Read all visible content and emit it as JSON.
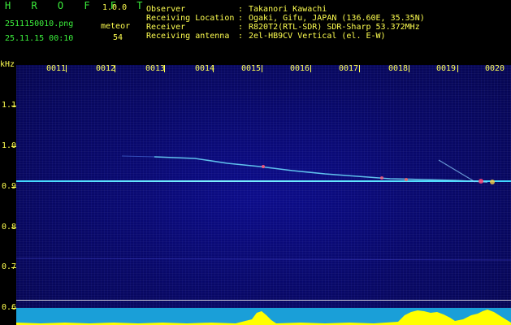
{
  "header": {
    "app_title": "H R O F F T",
    "version": "1.0.0",
    "file_name": "2511150010.png",
    "datetime": "25.11.15 00:10",
    "meteor_label": "meteor",
    "meteor_count": "54"
  },
  "info": [
    {
      "label": "Observer",
      "value": "Takanori Kawachi"
    },
    {
      "label": "Receiving Location",
      "value": "Ogaki, Gifu, JAPAN (136.60E, 35.35N)"
    },
    {
      "label": "Receiver",
      "value": "R820T2(RTL-SDR) SDR-Sharp 53.372MHz"
    },
    {
      "label": "Receiving antenna",
      "value": "2el-HB9CV Vertical (el. E-W)"
    }
  ],
  "axes": {
    "y_unit": "kHz",
    "y_ticks": [
      "1.1",
      "1.0",
      "0.9",
      "0.8",
      "0.7",
      "0.6"
    ],
    "x_ticks": [
      "0011",
      "0012",
      "0013",
      "0014",
      "0015",
      "0016",
      "0017",
      "0018",
      "0019",
      "0020"
    ]
  },
  "colors": {
    "background": "#000000",
    "plot": "#08086a",
    "header_green": "#3cf03c",
    "header_yellow": "#ffff50",
    "carrier": "#40d8ff",
    "noise_floor": "#ffff00"
  }
}
